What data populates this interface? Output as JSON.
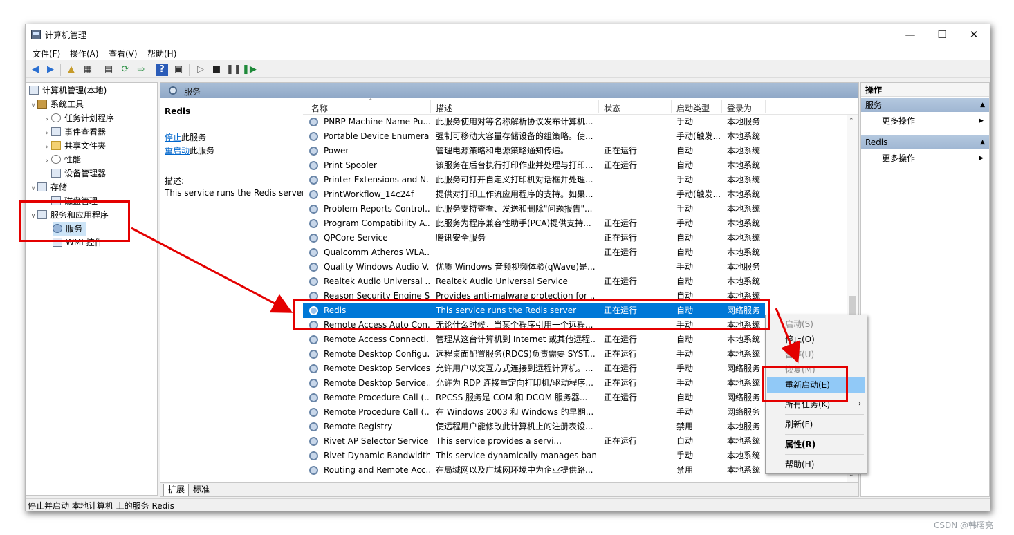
{
  "window": {
    "title": "计算机管理"
  },
  "menu": [
    "文件(F)",
    "操作(A)",
    "查看(V)",
    "帮助(H)"
  ],
  "tree": {
    "root": "计算机管理(本地)",
    "system_tools": "系统工具",
    "task_scheduler": "任务计划程序",
    "event_viewer": "事件查看器",
    "shared_folders": "共享文件夹",
    "performance": "性能",
    "device_manager": "设备管理器",
    "storage": "存储",
    "disk_management": "磁盘管理",
    "services_apps": "服务和应用程序",
    "services": "服务",
    "wmi": "WMI 控件"
  },
  "center": {
    "header": "服务",
    "detail": {
      "title": "Redis",
      "stop_link": "停止",
      "stop_suffix": "此服务",
      "restart_link": "重启动",
      "restart_suffix": "此服务",
      "desc_label": "描述:",
      "desc_text": "This service runs the Redis server"
    },
    "columns": {
      "name": "名称",
      "desc": "描述",
      "status": "状态",
      "startup": "启动类型",
      "logon": "登录为"
    },
    "rows": [
      [
        "PNRP Machine Name Pu...",
        "此服务使用对等名称解析协议发布计算机...",
        "",
        "手动",
        "本地服务"
      ],
      [
        "Portable Device Enumera...",
        "强制可移动大容量存储设备的组策略。使...",
        "",
        "手动(触发...",
        "本地系统"
      ],
      [
        "Power",
        "管理电源策略和电源策略通知传递。",
        "正在运行",
        "自动",
        "本地系统"
      ],
      [
        "Print Spooler",
        "该服务在后台执行打印作业并处理与打印...",
        "正在运行",
        "自动",
        "本地系统"
      ],
      [
        "Printer Extensions and N...",
        "此服务可打开自定义打印机对话框并处理...",
        "",
        "手动",
        "本地系统"
      ],
      [
        "PrintWorkflow_14c24f",
        "提供对打印工作流应用程序的支持。如果...",
        "",
        "手动(触发...",
        "本地系统"
      ],
      [
        "Problem Reports Control...",
        "此服务支持查看、发送和删除\"问题报告\"...",
        "",
        "手动",
        "本地系统"
      ],
      [
        "Program Compatibility A...",
        "此服务为程序兼容性助手(PCA)提供支持...",
        "正在运行",
        "手动",
        "本地系统"
      ],
      [
        "QPCore Service",
        "腾讯安全服务",
        "正在运行",
        "自动",
        "本地系统"
      ],
      [
        "Qualcomm Atheros WLA...",
        "",
        "正在运行",
        "自动",
        "本地系统"
      ],
      [
        "Quality Windows Audio V...",
        "优质 Windows 音频视频体验(qWave)是...",
        "",
        "手动",
        "本地服务"
      ],
      [
        "Realtek Audio Universal ...",
        "Realtek Audio Universal Service",
        "正在运行",
        "自动",
        "本地系统"
      ],
      [
        "Reason Security Engine S...",
        "Provides anti-malware protection for ...",
        "",
        "自动",
        "本地系统"
      ],
      [
        "Redis",
        "This service runs the Redis server",
        "正在运行",
        "自动",
        "网络服务"
      ],
      [
        "Remote Access Auto Con...",
        "无论什么时候，当某个程序引用一个远程...",
        "",
        "手动",
        "本地系统"
      ],
      [
        "Remote Access Connecti...",
        "管理从这台计算机到 Internet 或其他远程...",
        "正在运行",
        "自动",
        "本地系统"
      ],
      [
        "Remote Desktop Configu...",
        "远程桌面配置服务(RDCS)负责需要 SYST...",
        "正在运行",
        "手动",
        "本地系统"
      ],
      [
        "Remote Desktop Services",
        "允许用户以交互方式连接到远程计算机。...",
        "正在运行",
        "手动",
        "网络服务"
      ],
      [
        "Remote Desktop Service...",
        "允许为 RDP 连接重定向打印机/驱动程序...",
        "正在运行",
        "手动",
        "本地系统"
      ],
      [
        "Remote Procedure Call (...",
        "RPCSS 服务是 COM 和 DCOM 服务器...",
        "正在运行",
        "自动",
        "网络服务"
      ],
      [
        "Remote Procedure Call (...",
        "在 Windows 2003 和 Windows 的早期...",
        "",
        "手动",
        "网络服务"
      ],
      [
        "Remote Registry",
        "使远程用户能修改此计算机上的注册表设...",
        "",
        "禁用",
        "本地服务"
      ],
      [
        "Rivet AP Selector Service",
        "This service provides a servi...",
        "正在运行",
        "自动",
        "本地系统"
      ],
      [
        "Rivet Dynamic Bandwidth...",
        "This service dynamically manages ban...",
        "",
        "手动",
        "本地系统"
      ],
      [
        "Routing and Remote Acc...",
        "在局域网以及广域网环境中为企业提供路...",
        "",
        "禁用",
        "本地系统"
      ]
    ],
    "selected_row_index": 13,
    "tabs": [
      "扩展",
      "标准"
    ]
  },
  "actions": {
    "header": "操作",
    "sec1": "服务",
    "sec1_more": "更多操作",
    "sec2": "Redis",
    "sec2_more": "更多操作"
  },
  "context_menu": {
    "start": "启动(S)",
    "stop": "停止(O)",
    "pause": "暂停(U)",
    "resume": "恢复(M)",
    "restart": "重新启动(E)",
    "all_tasks": "所有任务(K)",
    "refresh": "刷新(F)",
    "properties": "属性(R)",
    "help": "帮助(H)"
  },
  "statusbar": "停止并启动 本地计算机 上的服务 Redis",
  "watermark": "CSDN @韩曙亮",
  "colors": {
    "selection": "#0078d7",
    "header_bar": "#a8bdd6",
    "annotation": "#e40000",
    "menu_highlight": "#91c9f7"
  }
}
